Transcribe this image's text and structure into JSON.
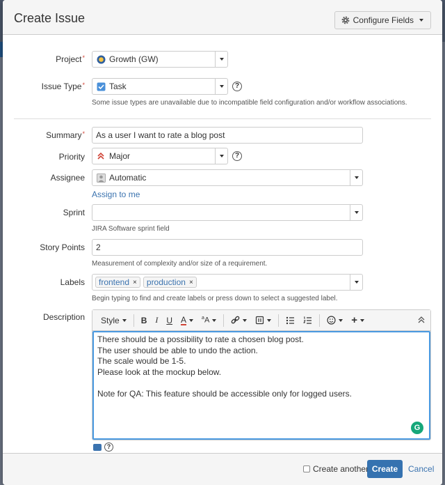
{
  "dialog": {
    "title": "Create Issue",
    "configure_fields_label": "Configure Fields"
  },
  "form": {
    "project": {
      "label": "Project",
      "value": "Growth (GW)"
    },
    "issue_type": {
      "label": "Issue Type",
      "value": "Task",
      "note": "Some issue types are unavailable due to incompatible field configuration and/or workflow associations."
    },
    "summary": {
      "label": "Summary",
      "value": "As a user I want to rate a blog post"
    },
    "priority": {
      "label": "Priority",
      "value": "Major"
    },
    "assignee": {
      "label": "Assignee",
      "value": "Automatic",
      "assign_to_me": "Assign to me"
    },
    "sprint": {
      "label": "Sprint",
      "value": "",
      "note": "JIRA Software sprint field"
    },
    "story_points": {
      "label": "Story Points",
      "value": "2",
      "note": "Measurement of complexity and/or size of a requirement."
    },
    "labels": {
      "label": "Labels",
      "tags": [
        "frontend",
        "production"
      ],
      "note": "Begin typing to find and create labels or press down to select a suggested label."
    },
    "description": {
      "label": "Description",
      "toolbar": {
        "style_label": "Style"
      },
      "lines": [
        "There should be a possibility to rate a chosen blog post.",
        "The user should be able to undo the action.",
        "The scale would be 1-5.",
        "Please look at the mockup below.",
        "",
        "Note for QA: This feature should be accessible only for logged users."
      ]
    }
  },
  "footer": {
    "create_another_label": "Create another",
    "create_label": "Create",
    "cancel_label": "Cancel"
  },
  "colors": {
    "primary": "#3572b0",
    "link": "#3b73af",
    "required": "#d04437",
    "focus": "#4a9ae1",
    "grammarly": "#15a77a",
    "priority_major": "#d04437",
    "task_icon": "#4a90d9"
  }
}
